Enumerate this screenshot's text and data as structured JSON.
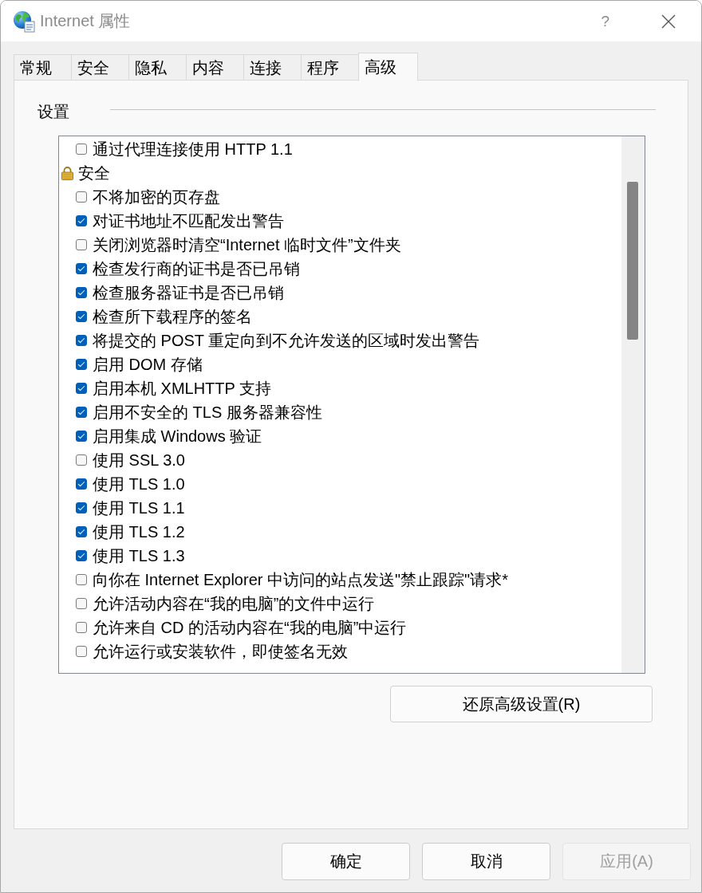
{
  "window": {
    "title": "Internet 属性",
    "help": "?"
  },
  "tabs": [
    {
      "label": "常规",
      "selected": false
    },
    {
      "label": "安全",
      "selected": false
    },
    {
      "label": "隐私",
      "selected": false
    },
    {
      "label": "内容",
      "selected": false
    },
    {
      "label": "连接",
      "selected": false
    },
    {
      "label": "程序",
      "selected": false
    },
    {
      "label": "高级",
      "selected": true
    }
  ],
  "settings": {
    "label": "设置",
    "items": [
      {
        "kind": "checkbox",
        "label": "通过代理连接使用 HTTP 1.1",
        "checked": false
      },
      {
        "kind": "category",
        "label": "安全",
        "children": [
          {
            "kind": "checkbox",
            "label": "不将加密的页存盘",
            "checked": false
          },
          {
            "kind": "checkbox",
            "label": "对证书地址不匹配发出警告",
            "checked": true
          },
          {
            "kind": "checkbox",
            "label": "关闭浏览器时清空“Internet 临时文件”文件夹",
            "checked": false
          },
          {
            "kind": "checkbox",
            "label": "检查发行商的证书是否已吊销",
            "checked": true
          },
          {
            "kind": "checkbox",
            "label": "检查服务器证书是否已吊销",
            "checked": true
          },
          {
            "kind": "checkbox",
            "label": "检查所下载程序的签名",
            "checked": true
          },
          {
            "kind": "checkbox",
            "label": "将提交的 POST 重定向到不允许发送的区域时发出警告",
            "checked": true
          },
          {
            "kind": "checkbox",
            "label": "启用 DOM 存储",
            "checked": true
          },
          {
            "kind": "checkbox",
            "label": "启用本机 XMLHTTP 支持",
            "checked": true
          },
          {
            "kind": "checkbox",
            "label": "启用不安全的 TLS 服务器兼容性",
            "checked": true
          },
          {
            "kind": "checkbox",
            "label": "启用集成 Windows 验证",
            "checked": true
          },
          {
            "kind": "checkbox",
            "label": "使用 SSL 3.0",
            "checked": false
          },
          {
            "kind": "checkbox",
            "label": "使用 TLS 1.0",
            "checked": true
          },
          {
            "kind": "checkbox",
            "label": "使用 TLS 1.1",
            "checked": true
          },
          {
            "kind": "checkbox",
            "label": "使用 TLS 1.2",
            "checked": true
          },
          {
            "kind": "checkbox",
            "label": "使用 TLS 1.3",
            "checked": true
          },
          {
            "kind": "checkbox",
            "label": "向你在 Internet Explorer 中访问的站点发送\"禁止跟踪\"请求*",
            "checked": false
          },
          {
            "kind": "checkbox",
            "label": "允许活动内容在“我的电脑”的文件中运行",
            "checked": false
          },
          {
            "kind": "checkbox",
            "label": "允许来自 CD 的活动内容在“我的电脑”中运行",
            "checked": false
          },
          {
            "kind": "checkbox",
            "label": "允许运行或安装软件，即使签名无效",
            "checked": false
          }
        ]
      }
    ]
  },
  "reset_button": {
    "label": "还原高级设置(R)"
  },
  "buttons": [
    {
      "label": "确定",
      "disabled": false
    },
    {
      "label": "取消",
      "disabled": false
    },
    {
      "label": "应用(A)",
      "disabled": true
    }
  ]
}
